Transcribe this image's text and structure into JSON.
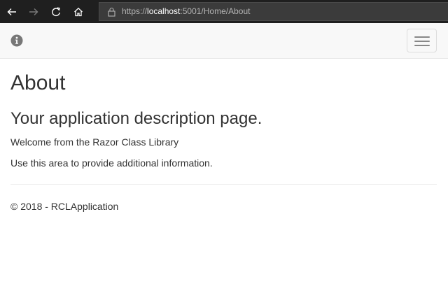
{
  "browser": {
    "url_scheme": "https://",
    "url_host": "localhost",
    "url_rest": ":5001/Home/About",
    "icons": [
      "back-arrow-icon",
      "forward-arrow-icon",
      "refresh-icon",
      "home-icon",
      "lock-icon"
    ]
  },
  "navbar": {
    "brand_icon": "info-circle-icon",
    "toggle_icon": "hamburger-icon"
  },
  "main": {
    "title": "About",
    "subtitle": "Your application description page.",
    "paragraphs": [
      "Welcome from the Razor Class Library",
      "Use this area to provide additional information."
    ]
  },
  "footer": {
    "text": "© 2018 - RCLApplication"
  },
  "colors": {
    "chrome_bg": "#1f1f1f",
    "navbar_bg": "#f8f8f8",
    "text": "#333333"
  }
}
